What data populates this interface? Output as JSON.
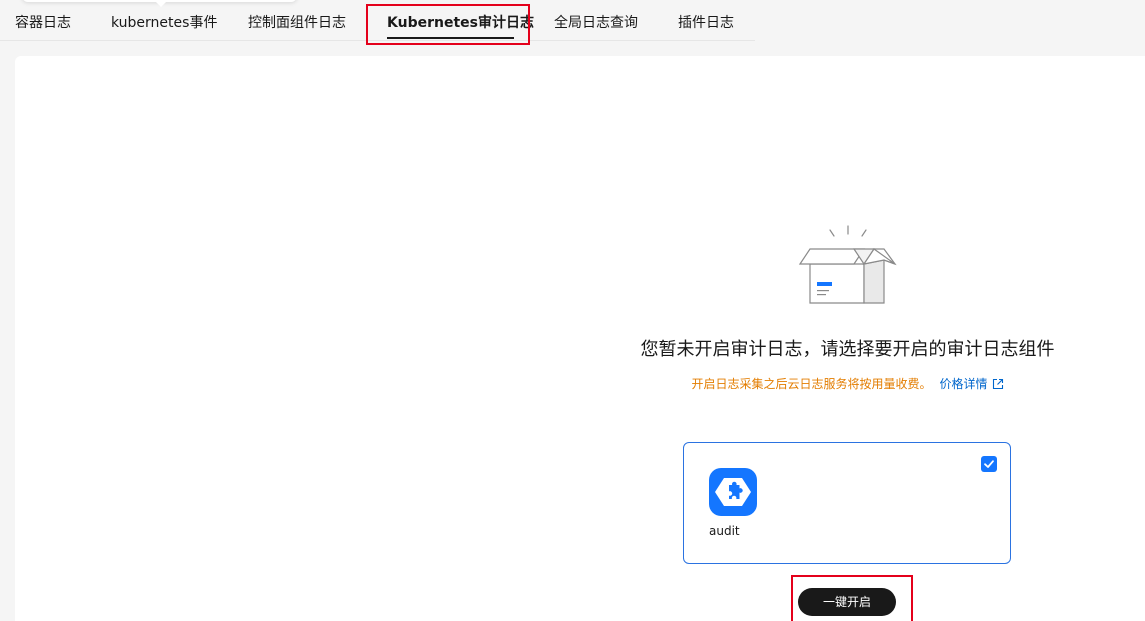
{
  "tabs": [
    {
      "label": "容器日志",
      "active": false
    },
    {
      "label": "kubernetes事件",
      "active": false
    },
    {
      "label": "控制面组件日志",
      "active": false
    },
    {
      "label": "Kubernetes审计日志",
      "active": true
    },
    {
      "label": "全局日志查询",
      "active": false
    },
    {
      "label": "插件日志",
      "active": false
    }
  ],
  "empty_state": {
    "illustration_icon": "open-box-icon",
    "title": "您暂未开启审计日志，请选择要开启的审计日志组件",
    "fee_note": "开启日志采集之后云日志服务将按用量收费。",
    "price_link": "价格详情",
    "price_link_icon": "external-link-icon"
  },
  "component_card": {
    "name": "audit",
    "icon": "puzzle-hexagon-icon",
    "checked": true,
    "check_icon": "checkmark-icon"
  },
  "enable_button": {
    "label": "一键开启"
  },
  "colors": {
    "accent": "#1476ff",
    "warning_text": "#e37d00",
    "link": "#0066cc",
    "highlight": "#e4001b",
    "primary_button": "#191919"
  }
}
